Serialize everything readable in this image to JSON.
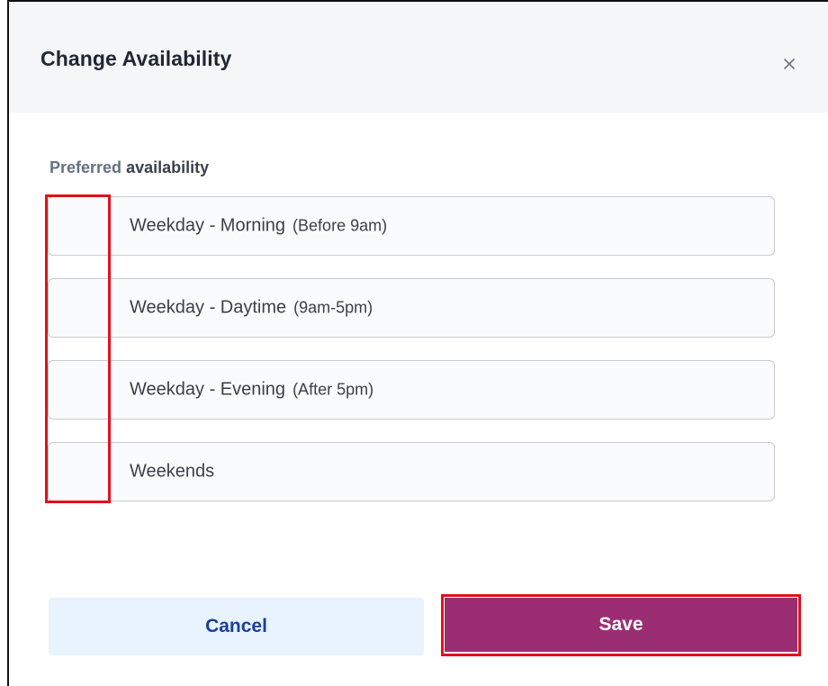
{
  "dialog": {
    "title": "Change Availability",
    "close_glyph": "×"
  },
  "section": {
    "label_part1": "Preferred",
    "label_part2": "availability"
  },
  "options": [
    {
      "label": "Weekday - Morning",
      "sub": "(Before 9am)"
    },
    {
      "label": "Weekday - Daytime",
      "sub": "(9am-5pm)"
    },
    {
      "label": "Weekday - Evening",
      "sub": "(After 5pm)"
    },
    {
      "label": "Weekends",
      "sub": ""
    }
  ],
  "buttons": {
    "cancel_label": "Cancel",
    "save_label": "Save"
  },
  "colors": {
    "save_bg": "#9b2e73",
    "cancel_bg": "#e8f3fd",
    "cancel_text": "#1a3f9c",
    "highlight": "#e0111b"
  },
  "icons": {
    "close": "close-icon"
  }
}
